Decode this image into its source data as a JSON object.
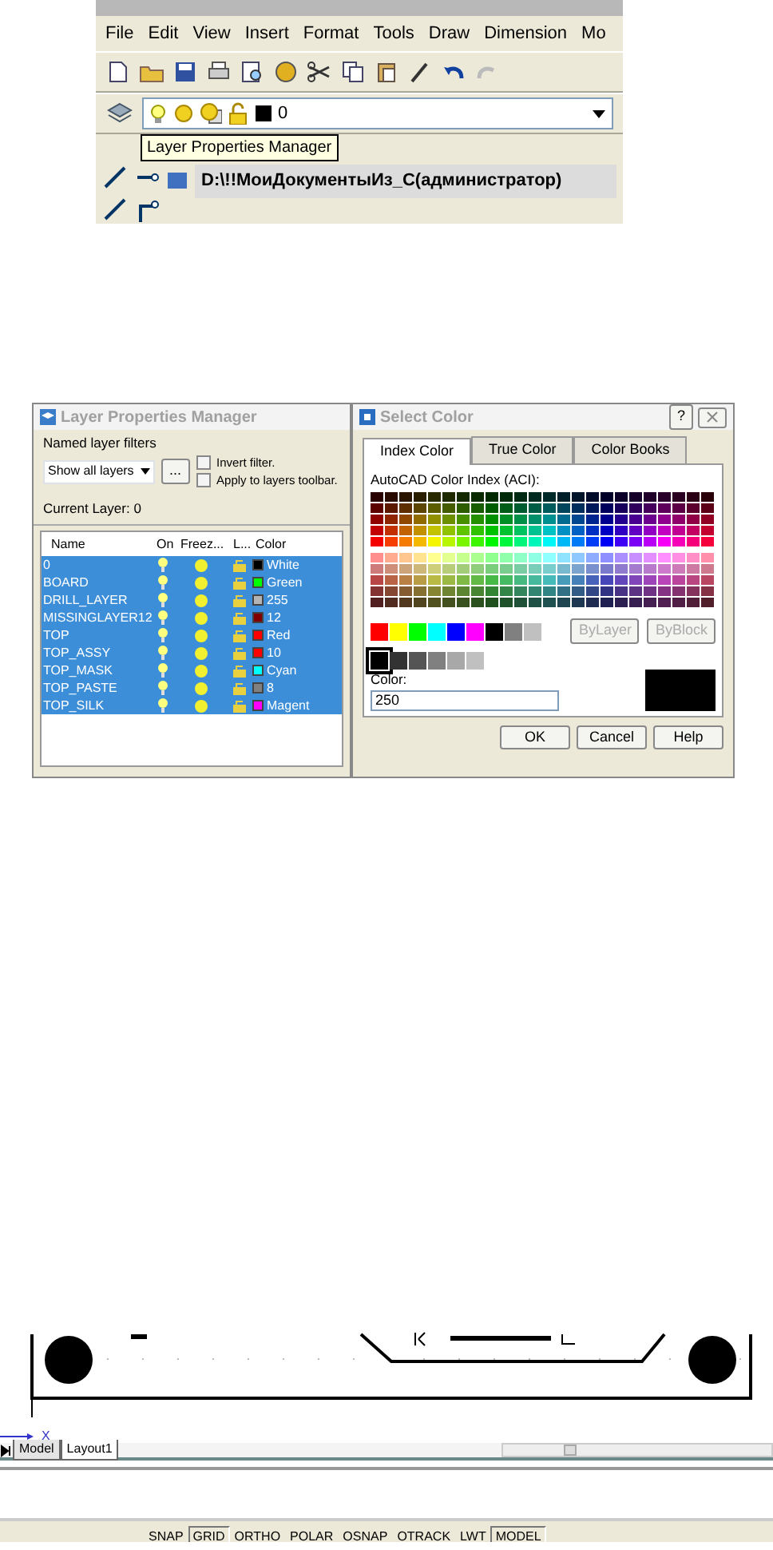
{
  "cad_window": {
    "menu": [
      "File",
      "Edit",
      "View",
      "Insert",
      "Format",
      "Tools",
      "Draw",
      "Dimension",
      "Mo"
    ],
    "current_layer": "0",
    "tooltip": "Layer Properties Manager",
    "drawing_title": "D:\\!!МоиДокументыИз_С(администратор)"
  },
  "layer_manager": {
    "title": "Layer Properties Manager",
    "filters_label": "Named layer filters",
    "filter_value": "Show all layers",
    "browse_button": "...",
    "options": [
      {
        "label": "Invert filter.",
        "checked": false
      },
      {
        "label": "Apply to layers toolbar.",
        "checked": false
      }
    ],
    "current_layer": "Current Layer:  0",
    "columns": [
      "Name",
      "On",
      "Freez...",
      "L...",
      "Color"
    ],
    "layers": [
      {
        "name": "0",
        "color": "#000000",
        "color_name": "White",
        "selected": true
      },
      {
        "name": "BOARD",
        "color": "#00ff00",
        "color_name": "Green",
        "selected": true
      },
      {
        "name": "DRILL_LAYER",
        "color": "#b4b4b4",
        "color_name": "255",
        "selected": true
      },
      {
        "name": "MISSINGLAYER12",
        "color": "#800000",
        "color_name": "12",
        "selected": true
      },
      {
        "name": "TOP",
        "color": "#ff0000",
        "color_name": "Red",
        "selected": true
      },
      {
        "name": "TOP_ASSY",
        "color": "#ff0000",
        "color_name": "10",
        "selected": true
      },
      {
        "name": "TOP_MASK",
        "color": "#00ffff",
        "color_name": "Cyan",
        "selected": true
      },
      {
        "name": "TOP_PASTE",
        "color": "#808080",
        "color_name": "8",
        "selected": true
      },
      {
        "name": "TOP_SILK",
        "color": "#ff00ff",
        "color_name": "Magent",
        "selected": true
      }
    ]
  },
  "select_color": {
    "title": "Select Color",
    "help_button": "?",
    "tabs": [
      {
        "label": "Index Color",
        "selected": true
      },
      {
        "label": "True Color",
        "selected": false
      },
      {
        "label": "Color Books",
        "selected": false
      }
    ],
    "palette_label": "AutoCAD Color Index (ACI):",
    "standard_colors": [
      {
        "color": "#ff0000",
        "selected": false
      },
      {
        "color": "#ffff00",
        "selected": false
      },
      {
        "color": "#00ff00",
        "selected": false
      },
      {
        "color": "#00ffff",
        "selected": false
      },
      {
        "color": "#0000ff",
        "selected": false
      },
      {
        "color": "#ff00ff",
        "selected": false
      },
      {
        "color": "#000000",
        "selected": false
      },
      {
        "color": "#808080",
        "selected": false
      },
      {
        "color": "#c0c0c0",
        "selected": false
      }
    ],
    "by_buttons": [
      {
        "label": "ByLayer",
        "disabled": true
      },
      {
        "label": "ByBlock",
        "disabled": true
      }
    ],
    "gray_colors": [
      {
        "color": "#000000",
        "selected": true
      },
      {
        "color": "#333333",
        "selected": false
      },
      {
        "color": "#555555",
        "selected": false
      },
      {
        "color": "#808080",
        "selected": false
      },
      {
        "color": "#a8a8a8",
        "selected": false
      },
      {
        "color": "#c0c0c0",
        "selected": false
      }
    ],
    "color_label": "Color:",
    "color_value": "250",
    "buttons": [
      "OK",
      "Cancel",
      "Help"
    ]
  },
  "drawing": {
    "axis_label": "X",
    "layout_tabs": [
      {
        "label": "Model",
        "selected": false
      },
      {
        "label": "Layout1",
        "selected": true
      }
    ],
    "status_buttons": [
      {
        "label": "SNAP",
        "on": false
      },
      {
        "label": "GRID",
        "on": true
      },
      {
        "label": "ORTHO",
        "on": false
      },
      {
        "label": "POLAR",
        "on": false
      },
      {
        "label": "OSNAP",
        "on": false
      },
      {
        "label": "OTRACK",
        "on": false
      },
      {
        "label": "LWT",
        "on": false
      },
      {
        "label": "MODEL",
        "on": true
      }
    ]
  }
}
